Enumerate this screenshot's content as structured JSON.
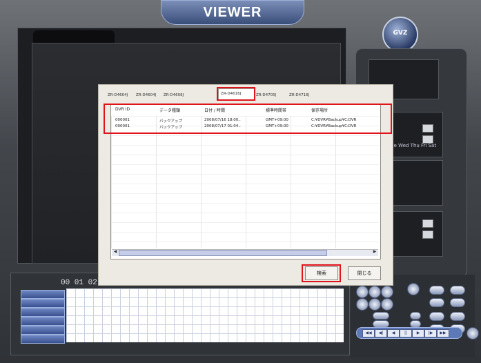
{
  "window": {
    "title": "VIEWER",
    "logo_text": "GVZ"
  },
  "timeline": {
    "timecode": "00 01 02"
  },
  "right_panel": {
    "weekdays": "Tue Wed Thu Fri Sat"
  },
  "dialog": {
    "tabs": [
      "ZR-D4604J",
      "ZR-D4604J",
      "ZR-D4608J",
      "ZR-D4616J",
      "ZR-D4705J",
      "ZR-D4716J"
    ],
    "active_tab": 3,
    "columns": [
      "DVR ID",
      "データ種類",
      "日付 / 時間",
      "標準時間帯",
      "保存場所"
    ],
    "rows": [
      [
        "000001",
        "バックアップ",
        "2008/07/16  18:00..",
        "GMT+09:00",
        "C:¥DVR¥Backup¥C:DVR"
      ],
      [
        "000001",
        "バックアップ",
        "2008/07/17  01:04..",
        "GMT+09:00",
        "C:¥DVR¥Backup¥C:DVR"
      ]
    ],
    "search_label": "検索",
    "close_label": "閉じる"
  },
  "colors": {
    "highlight": "#e0131b",
    "accent": "#5e79b8"
  }
}
